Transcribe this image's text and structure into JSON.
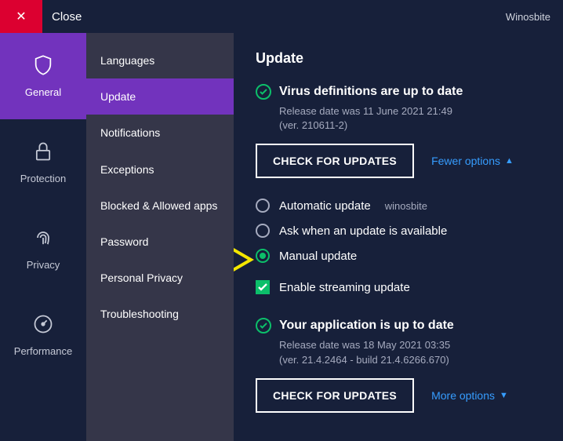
{
  "titlebar": {
    "close_label": "Close",
    "watermark": "Winosbite"
  },
  "rail": {
    "items": [
      {
        "label": "General"
      },
      {
        "label": "Protection"
      },
      {
        "label": "Privacy"
      },
      {
        "label": "Performance"
      }
    ]
  },
  "subnav": {
    "items": [
      {
        "label": "Languages"
      },
      {
        "label": "Update"
      },
      {
        "label": "Notifications"
      },
      {
        "label": "Exceptions"
      },
      {
        "label": "Blocked & Allowed apps"
      },
      {
        "label": "Password"
      },
      {
        "label": "Personal Privacy"
      },
      {
        "label": "Troubleshooting"
      }
    ]
  },
  "content": {
    "heading": "Update",
    "virus": {
      "title": "Virus definitions are up to date",
      "sub1": "Release date was 11 June 2021 21:49",
      "sub2": "(ver. 210611-2)",
      "check_btn": "CHECK FOR UPDATES",
      "toggle": "Fewer options"
    },
    "options": {
      "auto": "Automatic update",
      "auto_wm": "winosbite",
      "ask": "Ask when an update is available",
      "manual": "Manual update",
      "streaming": "Enable streaming update"
    },
    "app": {
      "title": "Your application is up to date",
      "sub1": "Release date was 18 May 2021 03:35",
      "sub2": "(ver. 21.4.2464 - build 21.4.6266.670)",
      "check_btn": "CHECK FOR UPDATES",
      "toggle": "More options"
    }
  }
}
